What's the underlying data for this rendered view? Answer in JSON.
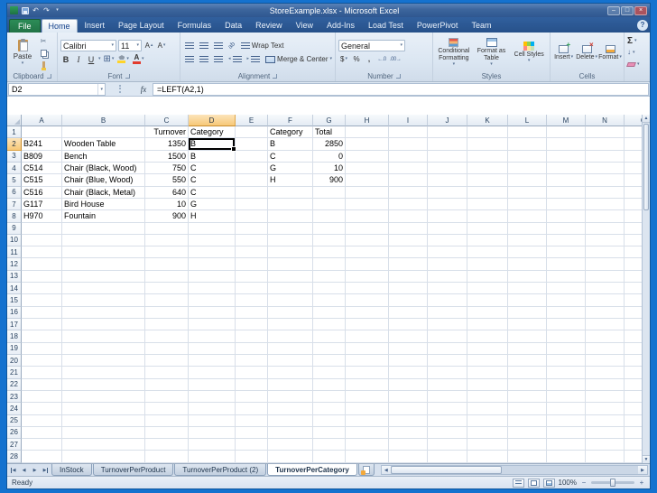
{
  "window": {
    "title": "StoreExample.xlsx - Microsoft Excel"
  },
  "ribbon": {
    "file_tab": "File",
    "tabs": [
      {
        "label": "Home",
        "active": true
      },
      {
        "label": "Insert"
      },
      {
        "label": "Page Layout"
      },
      {
        "label": "Formulas"
      },
      {
        "label": "Data"
      },
      {
        "label": "Review"
      },
      {
        "label": "View"
      },
      {
        "label": "Add-Ins"
      },
      {
        "label": "Load Test"
      },
      {
        "label": "PowerPivot"
      },
      {
        "label": "Team"
      }
    ],
    "groups": {
      "clipboard": {
        "label": "Clipboard",
        "paste": "Paste"
      },
      "font": {
        "label": "Font",
        "font_name": "Calibri",
        "font_size": "11",
        "bold": "B",
        "italic": "I",
        "underline": "U",
        "grow": "A",
        "shrink": "A",
        "color_letter": "A"
      },
      "alignment": {
        "label": "Alignment",
        "wrap_text": "Wrap Text",
        "merge_center": "Merge & Center"
      },
      "number": {
        "label": "Number",
        "format": "General",
        "currency": "$",
        "percent": "%",
        "comma": ","
      },
      "styles": {
        "label": "Styles",
        "conditional": "Conditional Formatting",
        "format_table": "Format as Table",
        "cell_styles": "Cell Styles"
      },
      "cells": {
        "label": "Cells",
        "insert": "Insert",
        "delete": "Delete",
        "format": "Format"
      },
      "editing": {
        "autosum": "Σ"
      }
    }
  },
  "formula_bar": {
    "name_box": "D2",
    "fx_label": "fx",
    "formula": "=LEFT(A2,1)"
  },
  "grid": {
    "column_letters": [
      "A",
      "B",
      "C",
      "D",
      "E",
      "F",
      "G",
      "H",
      "I",
      "J",
      "K",
      "L",
      "M",
      "N",
      "O"
    ],
    "row_count": 28,
    "active_cell": "D2",
    "selected_column": "D",
    "selected_row": 2,
    "cells": {
      "C1": {
        "text": "Turnover",
        "align": "right"
      },
      "D1": {
        "text": "Category",
        "align": "left"
      },
      "F1": {
        "text": "Category",
        "align": "left"
      },
      "G1": {
        "text": "Total",
        "align": "left"
      },
      "A2": {
        "text": "B241",
        "align": "left"
      },
      "B2": {
        "text": "Wooden Table",
        "align": "left"
      },
      "C2": {
        "text": "1350",
        "align": "right"
      },
      "D2": {
        "text": "B",
        "align": "left"
      },
      "F2": {
        "text": "B",
        "align": "left"
      },
      "G2": {
        "text": "2850",
        "align": "right"
      },
      "A3": {
        "text": "B809",
        "align": "left"
      },
      "B3": {
        "text": "Bench",
        "align": "left"
      },
      "C3": {
        "text": "1500",
        "align": "right"
      },
      "D3": {
        "text": "B",
        "align": "left"
      },
      "F3": {
        "text": "C",
        "align": "left"
      },
      "G3": {
        "text": "0",
        "align": "right"
      },
      "A4": {
        "text": "C514",
        "align": "left"
      },
      "B4": {
        "text": "Chair (Black, Wood)",
        "align": "left"
      },
      "C4": {
        "text": "750",
        "align": "right"
      },
      "D4": {
        "text": "C",
        "align": "left"
      },
      "F4": {
        "text": "G",
        "align": "left"
      },
      "G4": {
        "text": "10",
        "align": "right"
      },
      "A5": {
        "text": "C515",
        "align": "left"
      },
      "B5": {
        "text": "Chair (Blue, Wood)",
        "align": "left"
      },
      "C5": {
        "text": "550",
        "align": "right"
      },
      "D5": {
        "text": "C",
        "align": "left"
      },
      "F5": {
        "text": "H",
        "align": "left"
      },
      "G5": {
        "text": "900",
        "align": "right"
      },
      "A6": {
        "text": "C516",
        "align": "left"
      },
      "B6": {
        "text": "Chair (Black, Metal)",
        "align": "left"
      },
      "C6": {
        "text": "640",
        "align": "right"
      },
      "D6": {
        "text": "C",
        "align": "left"
      },
      "A7": {
        "text": "G117",
        "align": "left"
      },
      "B7": {
        "text": "Bird House",
        "align": "left"
      },
      "C7": {
        "text": "10",
        "align": "right"
      },
      "D7": {
        "text": "G",
        "align": "left"
      },
      "A8": {
        "text": "H970",
        "align": "left"
      },
      "B8": {
        "text": "Fountain",
        "align": "left"
      },
      "C8": {
        "text": "900",
        "align": "right"
      },
      "D8": {
        "text": "H",
        "align": "left"
      }
    }
  },
  "sheet_bar": {
    "tabs": [
      {
        "label": "InStock"
      },
      {
        "label": "TurnoverPerProduct"
      },
      {
        "label": "TurnoverPerProduct (2)"
      },
      {
        "label": "TurnoverPerCategory",
        "active": true
      }
    ]
  },
  "status_bar": {
    "mode": "Ready",
    "zoom": "100%"
  },
  "icons": {
    "dropdown": "▾",
    "up_small": "▴",
    "undo": "↶",
    "redo": "↷",
    "minimize": "–",
    "maximize": "□",
    "close": "×",
    "help": "?",
    "scissors": "✂",
    "borders": "⊞",
    "orientation": "ab",
    "increase_decimal": "←.0",
    "decrease_decimal": ".00→",
    "indent_left": "◂",
    "indent_right": "▸",
    "nav_first": "◀",
    "nav_prev": "◀",
    "nav_next": "▶",
    "nav_last": "▶",
    "scroll_left": "◀",
    "scroll_right": "▶",
    "scroll_up": "▲",
    "scroll_down": "▼",
    "fill_down": "↓",
    "minus": "−",
    "plus": "+"
  },
  "colors": {
    "slide_blue": "#1472cf",
    "file_tab_green": "#217346",
    "selection_header": "#f7c877",
    "active_cell_border": "#000000"
  }
}
